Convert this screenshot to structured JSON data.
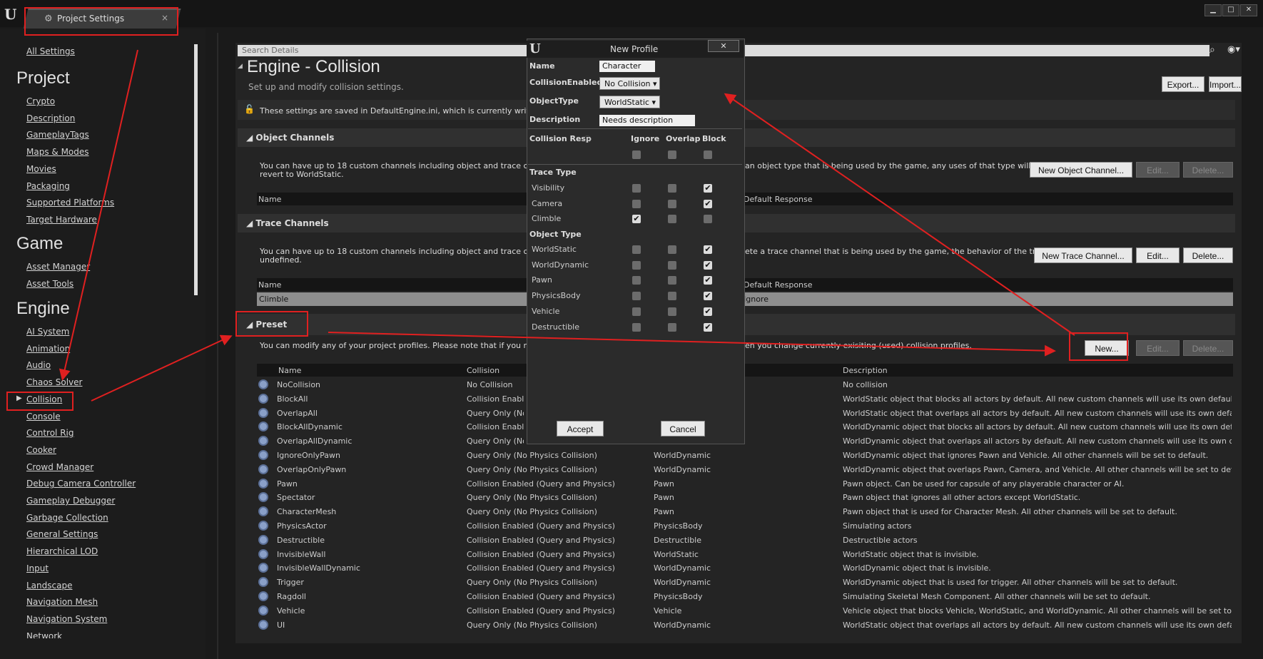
{
  "window": {
    "tab_title": "Project Settings",
    "tab_close": "×",
    "min": "▁",
    "max": "□",
    "close": "✕",
    "logo": "U"
  },
  "nav": {
    "all_settings": "All Settings",
    "project_header": "Project",
    "project_items": [
      "Crypto",
      "Description",
      "GameplayTags",
      "Maps & Modes",
      "Movies",
      "Packaging",
      "Supported Platforms",
      "Target Hardware"
    ],
    "game_header": "Game",
    "game_items": [
      "Asset Manager",
      "Asset Tools"
    ],
    "engine_header": "Engine",
    "engine_items": [
      "AI System",
      "Animation",
      "Audio",
      "Chaos Solver",
      "Collision",
      "Console",
      "Control Rig",
      "Cooker",
      "Crowd Manager",
      "Debug Camera Controller",
      "Gameplay Debugger",
      "Garbage Collection",
      "General Settings",
      "Hierarchical LOD",
      "Input",
      "Landscape",
      "Navigation Mesh",
      "Navigation System",
      "Network"
    ],
    "selected": "Collision"
  },
  "main": {
    "search_placeholder": "Search Details",
    "title": "Engine - Collision",
    "subtitle": "Set up and modify collision settings.",
    "export": "Export...",
    "import": "Import...",
    "notice": "These settings are saved in DefaultEngine.ini, which is currently writable.",
    "object_channels": {
      "title": "Object Channels",
      "desc_left": "You can have up to 18 custom channels including object and trace channel",
      "desc_left2": "revert to WorldStatic.",
      "desc_right": "an object type that is being used by the game, any uses of that type will",
      "new_btn": "New Object Channel...",
      "edit": "Edit...",
      "delete": "Delete...",
      "col_name": "Name",
      "col_default": "Default Response"
    },
    "trace_channels": {
      "title": "Trace Channels",
      "desc_left": "You can have up to 18 custom channels including object and trace channel",
      "desc_left2": "undefined.",
      "desc_right": "ete a trace channel that is being used by the game, the behavior of the trace is",
      "new_btn": "New Trace Channel...",
      "edit": "Edit...",
      "delete": "Delete...",
      "col_name": "Name",
      "col_default": "Default Response",
      "row_name": "Climble",
      "row_default": "Ignore"
    },
    "preset": {
      "title": "Preset",
      "desc_left": "You can modify any of your project profiles. Please note that if you modify",
      "desc_right": "en you change currently exisiting (used) collision profiles.",
      "new_btn": "New...",
      "edit": "Edit...",
      "delete": "Delete...",
      "cols": [
        "Name",
        "Collision",
        "",
        "Description"
      ],
      "rows": [
        [
          "NoCollision",
          "No Collision",
          "",
          "No collision"
        ],
        [
          "BlockAll",
          "Collision Enable",
          "",
          "WorldStatic object that blocks all actors by default. All new custom channels will use its own default respo"
        ],
        [
          "OverlapAll",
          "Query Only (No",
          "",
          "WorldStatic object that overlaps all actors by default. All new custom channels will use its own default res"
        ],
        [
          "BlockAllDynamic",
          "Collision Enable",
          "",
          "WorldDynamic object that blocks all actors by default. All new custom channels will use its own default res"
        ],
        [
          "OverlapAllDynamic",
          "Query Only (No",
          "",
          "WorldDynamic object that overlaps all actors by default. All new custom channels will use its own default r"
        ],
        [
          "IgnoreOnlyPawn",
          "Query Only (No Physics Collision)",
          "WorldDynamic",
          "WorldDynamic object that ignores Pawn and Vehicle. All other channels will be set to default."
        ],
        [
          "OverlapOnlyPawn",
          "Query Only (No Physics Collision)",
          "WorldDynamic",
          "WorldDynamic object that overlaps Pawn, Camera, and Vehicle. All other channels will be set to default."
        ],
        [
          "Pawn",
          "Collision Enabled (Query and Physics)",
          "Pawn",
          "Pawn object. Can be used for capsule of any playerable character or AI."
        ],
        [
          "Spectator",
          "Query Only (No Physics Collision)",
          "Pawn",
          "Pawn object that ignores all other actors except WorldStatic."
        ],
        [
          "CharacterMesh",
          "Query Only (No Physics Collision)",
          "Pawn",
          "Pawn object that is used for Character Mesh. All other channels will be set to default."
        ],
        [
          "PhysicsActor",
          "Collision Enabled (Query and Physics)",
          "PhysicsBody",
          "Simulating actors"
        ],
        [
          "Destructible",
          "Collision Enabled (Query and Physics)",
          "Destructible",
          "Destructible actors"
        ],
        [
          "InvisibleWall",
          "Collision Enabled (Query and Physics)",
          "WorldStatic",
          "WorldStatic object that is invisible."
        ],
        [
          "InvisibleWallDynamic",
          "Collision Enabled (Query and Physics)",
          "WorldDynamic",
          "WorldDynamic object that is invisible."
        ],
        [
          "Trigger",
          "Query Only (No Physics Collision)",
          "WorldDynamic",
          "WorldDynamic object that is used for trigger. All other channels will be set to default."
        ],
        [
          "Ragdoll",
          "Collision Enabled (Query and Physics)",
          "PhysicsBody",
          "Simulating Skeletal Mesh Component. All other channels will be set to default."
        ],
        [
          "Vehicle",
          "Collision Enabled (Query and Physics)",
          "Vehicle",
          "Vehicle object that blocks Vehicle, WorldStatic, and WorldDynamic. All other channels will be set to default"
        ],
        [
          "UI",
          "Query Only (No Physics Collision)",
          "WorldDynamic",
          "WorldStatic object that overlaps all actors by default. All new custom channels will use its own default res"
        ]
      ]
    }
  },
  "dialog": {
    "title": "New Profile",
    "close": "✕",
    "name_label": "Name",
    "name_value": "Character",
    "enabled_label": "CollisionEnabled",
    "enabled_value": "No Collision",
    "objtype_label": "ObjectType",
    "objtype_value": "WorldStatic",
    "desc_label": "Description",
    "desc_value": "Needs description",
    "resp_label": "Collision Resp",
    "col_ignore": "Ignore",
    "col_overlap": "Overlap",
    "col_block": "Block",
    "trace_header": "Trace Type",
    "trace_rows": [
      {
        "name": "Visibility",
        "val": "Block"
      },
      {
        "name": "Camera",
        "val": "Block"
      },
      {
        "name": "Climble",
        "val": "Ignore"
      }
    ],
    "object_header": "Object Type",
    "object_rows": [
      {
        "name": "WorldStatic",
        "val": "Block"
      },
      {
        "name": "WorldDynamic",
        "val": "Block"
      },
      {
        "name": "Pawn",
        "val": "Block"
      },
      {
        "name": "PhysicsBody",
        "val": "Block"
      },
      {
        "name": "Vehicle",
        "val": "Block"
      },
      {
        "name": "Destructible",
        "val": "Block"
      }
    ],
    "accept": "Accept",
    "cancel": "Cancel"
  },
  "colors": {
    "annotation": "#e02020",
    "check": "✔"
  }
}
